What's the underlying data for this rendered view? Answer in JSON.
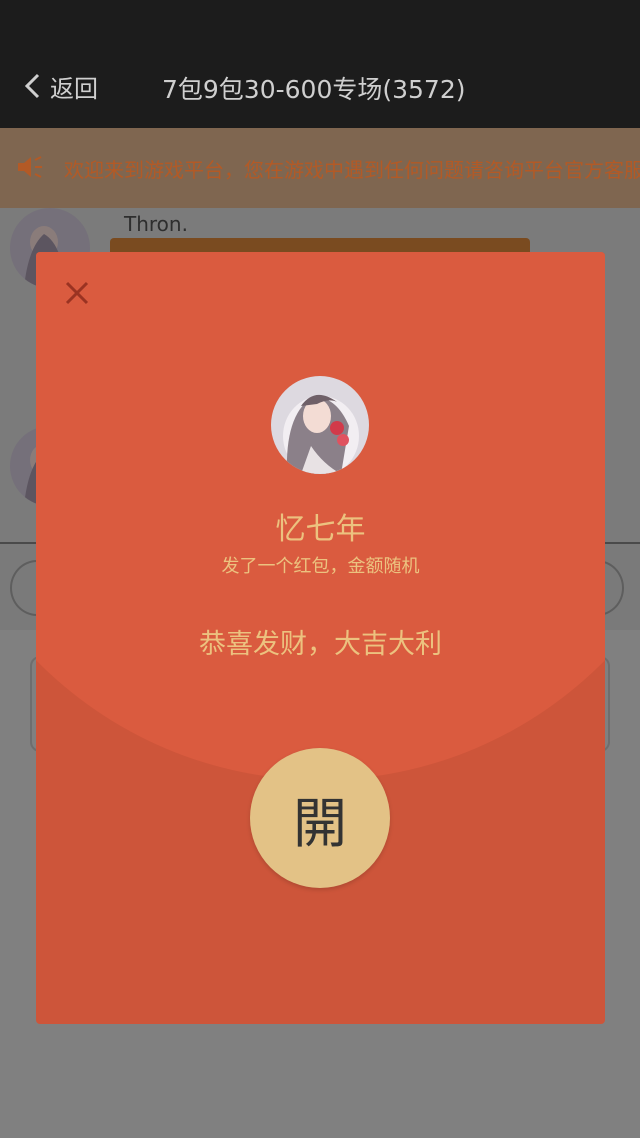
{
  "nav": {
    "back_label": "返回",
    "title": "7包9包30-600专场(3572)"
  },
  "notice": {
    "icon": "speaker-icon",
    "text": "欢迎来到游戏平台，您在游戏中遇到任何问题请咨询平台官方客服"
  },
  "chat": {
    "messages": [
      {
        "sender": "Thron."
      }
    ]
  },
  "red_envelope": {
    "sender_name": "忆七年",
    "subtitle": "发了一个红包，金额随机",
    "wish": "恭喜发财，大吉大利",
    "open_label": "開",
    "colors": {
      "body": "#cd553a",
      "top": "#da5b3f",
      "text": "#ecc27f",
      "button": "#e3c286"
    }
  }
}
